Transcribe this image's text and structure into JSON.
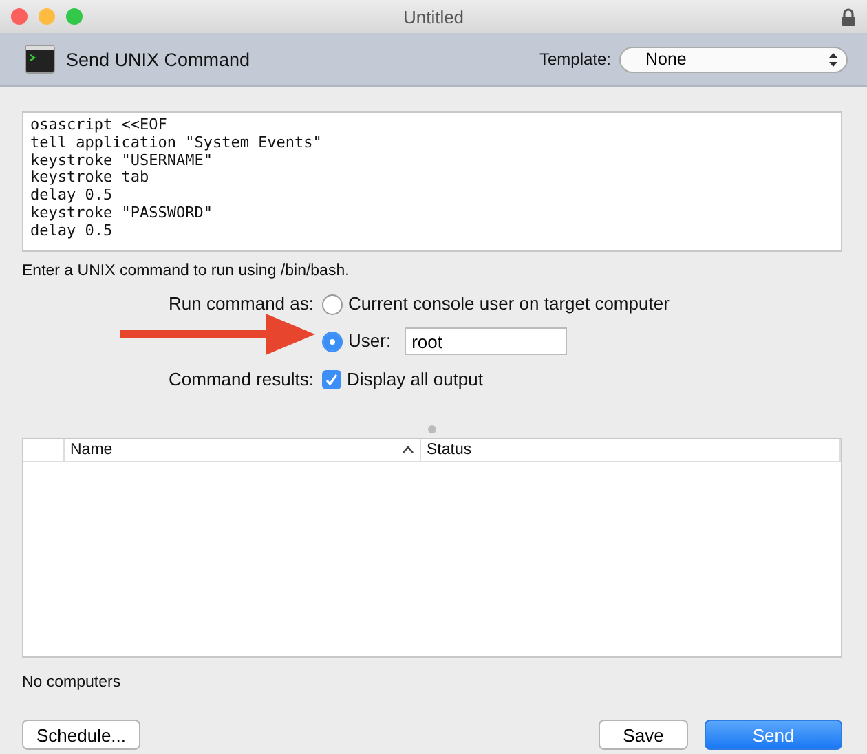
{
  "window": {
    "title": "Untitled"
  },
  "toolbar": {
    "title": "Send UNIX Command",
    "template_label": "Template:",
    "template_value": "None"
  },
  "script_lines": [
    "osascript <<EOF",
    "tell application \"System Events\"",
    "keystroke \"USERNAME\"",
    "keystroke tab",
    "delay 0.5",
    "keystroke \"PASSWORD\"",
    "delay 0.5"
  ],
  "help_text": "Enter a UNIX command to run using /bin/bash.",
  "run_as": {
    "label": "Run command as:",
    "options": [
      {
        "kind": "plain",
        "label": "Current console user on target computer",
        "selected": false
      },
      {
        "kind": "user",
        "label": "User:",
        "value": "root",
        "selected": true
      }
    ]
  },
  "results": {
    "label": "Command results:",
    "option": {
      "label": "Display all output",
      "checked": true
    }
  },
  "table": {
    "columns": [
      {
        "label": "Name",
        "sorted": true
      },
      {
        "label": "Status",
        "sorted": false
      }
    ]
  },
  "status": "No computers",
  "buttons": [
    {
      "label": "Schedule...",
      "kind": "plain"
    },
    {
      "label": "Save",
      "kind": "plain"
    },
    {
      "label": "Send",
      "kind": "default"
    }
  ]
}
